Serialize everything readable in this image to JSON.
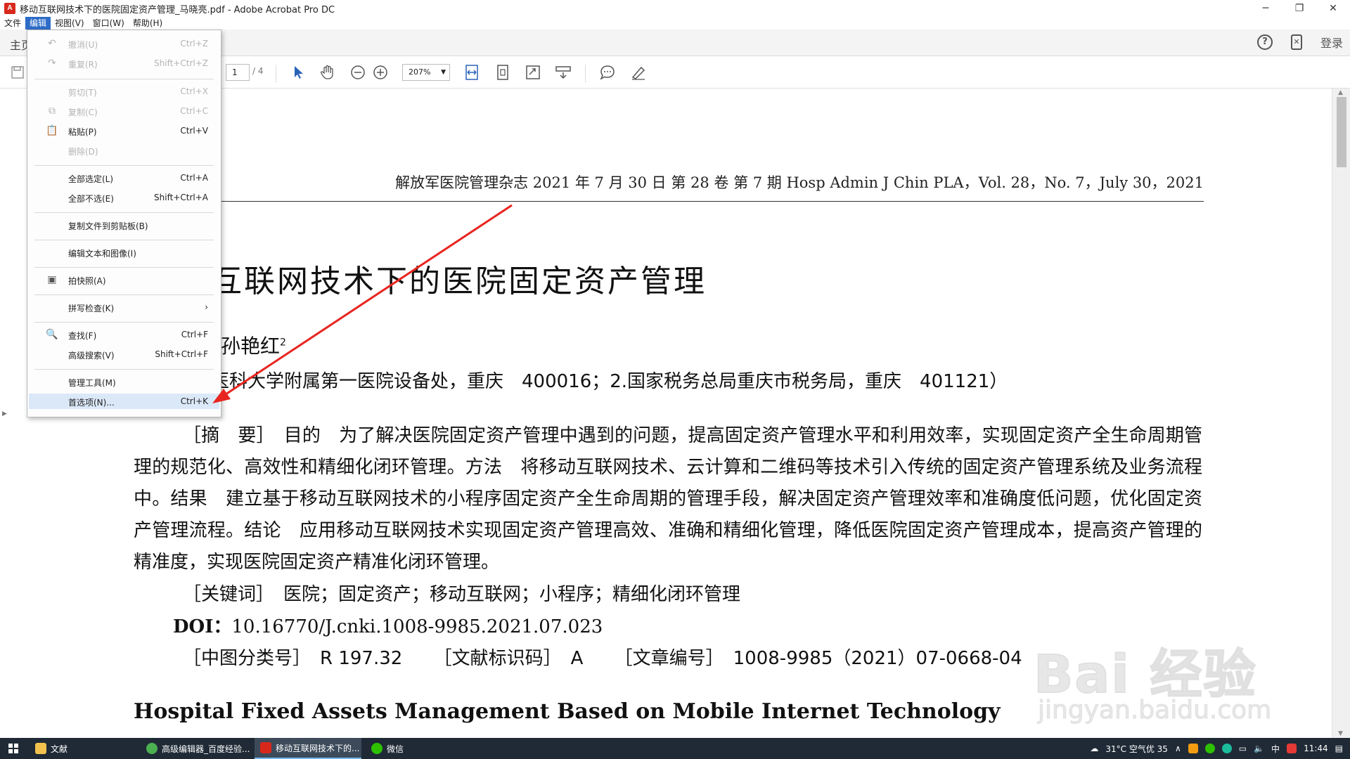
{
  "window": {
    "title": "移动互联网技术下的医院固定资产管理_马晓亮.pdf - Adobe Acrobat Pro DC",
    "app_icon": "acrobat-icon",
    "controls": [
      "minimize-icon",
      "maximize-icon",
      "close-icon"
    ]
  },
  "menubar": {
    "items": [
      {
        "label": "文件",
        "active": false
      },
      {
        "label": "编辑",
        "active": true
      },
      {
        "label": "视图(V)",
        "active": false
      },
      {
        "label": "窗口(W)",
        "active": false
      },
      {
        "label": "帮助(H)",
        "active": false
      }
    ]
  },
  "tabbar": {
    "home": "主页",
    "login": "登录"
  },
  "toolbar": {
    "page_current": "1",
    "page_total": "/ 4",
    "zoom": "207%"
  },
  "dropdown": {
    "items": [
      {
        "label": "撤消(U)",
        "shortcut": "Ctrl+Z",
        "disabled": true,
        "icon": "undo-icon"
      },
      {
        "label": "重复(R)",
        "shortcut": "Shift+Ctrl+Z",
        "disabled": true,
        "icon": "redo-icon"
      },
      {
        "label": "剪切(T)",
        "shortcut": "Ctrl+X",
        "disabled": true,
        "icon": ""
      },
      {
        "label": "复制(C)",
        "shortcut": "Ctrl+C",
        "disabled": true,
        "icon": "copy-icon"
      },
      {
        "label": "粘贴(P)",
        "shortcut": "Ctrl+V",
        "disabled": false,
        "icon": "paste-icon"
      },
      {
        "label": "删除(D)",
        "shortcut": "",
        "disabled": true,
        "icon": ""
      },
      {
        "label": "全部选定(L)",
        "shortcut": "Ctrl+A",
        "disabled": false,
        "icon": ""
      },
      {
        "label": "全部不选(E)",
        "shortcut": "Shift+Ctrl+A",
        "disabled": false,
        "icon": ""
      },
      {
        "label": "复制文件到剪贴板(B)",
        "shortcut": "",
        "disabled": false,
        "icon": ""
      },
      {
        "label": "编辑文本和图像(I)",
        "shortcut": "",
        "disabled": false,
        "icon": ""
      },
      {
        "label": "拍快照(A)",
        "shortcut": "",
        "disabled": false,
        "icon": "camera-icon"
      },
      {
        "label": "拼写检查(K)",
        "shortcut": "›",
        "disabled": false,
        "icon": ""
      },
      {
        "label": "查找(F)",
        "shortcut": "Ctrl+F",
        "disabled": false,
        "icon": "search-icon"
      },
      {
        "label": "高级搜索(V)",
        "shortcut": "Shift+Ctrl+F",
        "disabled": false,
        "icon": ""
      },
      {
        "label": "管理工具(M)",
        "shortcut": "",
        "disabled": false,
        "icon": ""
      },
      {
        "label": "首选项(N)...",
        "shortcut": "Ctrl+K",
        "disabled": false,
        "icon": ""
      }
    ]
  },
  "document": {
    "journal_header": "解放军医院管理杂志 2021 年 7 月 30 日 第 28 卷 第 7 期 Hosp Admin J Chin PLA，Vol. 28，No. 7，July 30，2021",
    "title": "互联网技术下的医院固定资产管理",
    "authors": "孙艳红",
    "authors_sup": "2",
    "affiliation": "医科大学附属第一医院设备处，重庆　400016；2.国家税务总局重庆市税务局，重庆　401121）",
    "abstract": "［摘　要］　目的　为了解决医院固定资产管理中遇到的问题，提高固定资产管理水平和利用效率，实现固定资产全生命周期管理的规范化、高效性和精细化闭环管理。方法　将移动互联网技术、云计算和二维码等技术引入传统的固定资产管理系统及业务流程中。结果　建立基于移动互联网技术的小程序固定资产全生命周期的管理手段，解决固定资产管理效率和准确度低问题，优化固定资产管理流程。结论　应用移动互联网技术实现固定资产管理高效、准确和精细化管理，降低医院固定资产管理成本，提高资产管理的精准度，实现医院固定资产精准化闭环管理。",
    "keywords": "［关键词］　医院；固定资产；移动互联网；小程序；精细化闭环管理",
    "doi_label": "DOI：",
    "doi_value": "10.16770/J.cnki.1008-9985.2021.07.023",
    "class_no": "［中图分类号］　R 197.32",
    "doc_code": "［文献标识码］　A",
    "article_no": "［文章编号］　1008-9985（2021）07-0668-04",
    "english_title": "Hospital Fixed Assets Management Based on Mobile Internet Technology"
  },
  "watermark": {
    "brand": "Bai 经验",
    "url": "jingyan.baidu.com"
  },
  "taskbar": {
    "tasks": [
      {
        "label": "文献",
        "icon": "folder-icon",
        "color": "#f2c14e",
        "active": false
      },
      {
        "label": "高级编辑器_百度经验...",
        "icon": "chrome-icon",
        "color": "#4caf50",
        "active": false
      },
      {
        "label": "移动互联网技术下的...",
        "icon": "acrobat-icon",
        "color": "#d8281c",
        "active": true
      },
      {
        "label": "微信",
        "icon": "wechat-icon",
        "color": "#2dc100",
        "active": false
      }
    ],
    "weather": "31°C 空气优 35",
    "ime": "中",
    "time": "11:44"
  },
  "colors": {
    "menu_active": "#2d6cc7",
    "menu_hover": "#dbe8f8",
    "arrow": "#e8251f",
    "taskbar": "#1f2a36"
  }
}
